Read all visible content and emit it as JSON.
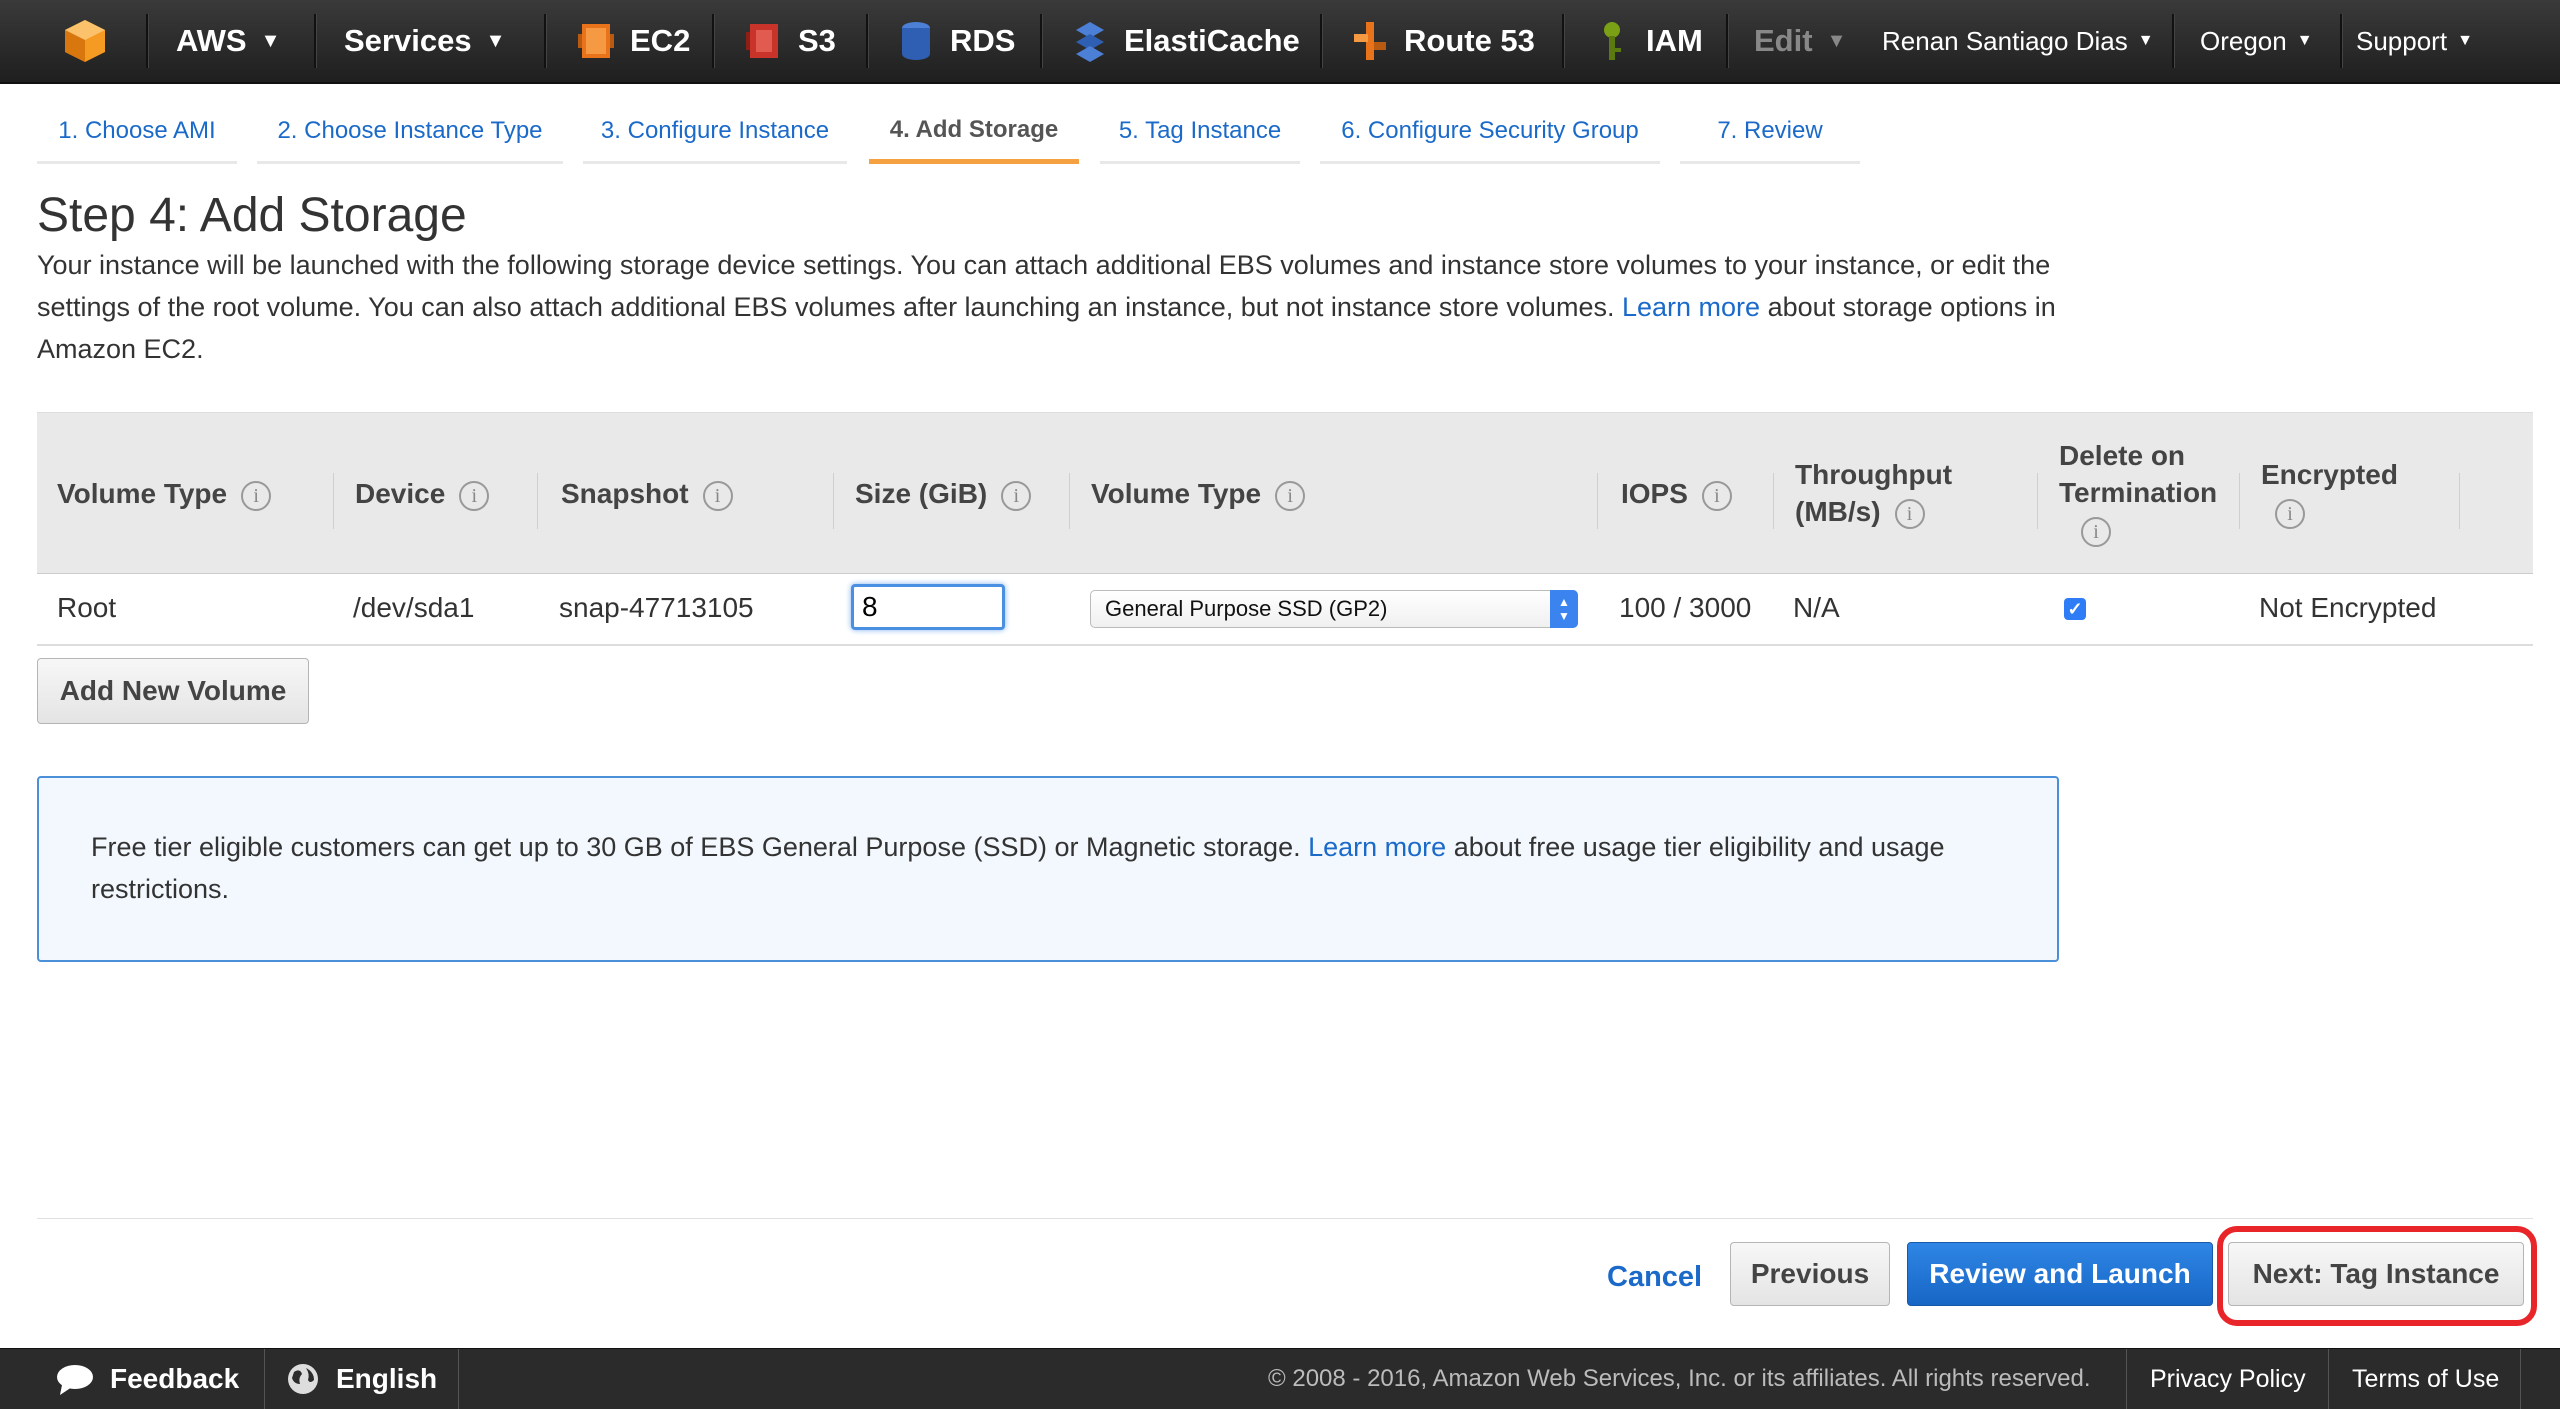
{
  "nav": {
    "aws": "AWS",
    "services": "Services",
    "ec2": "EC2",
    "s3": "S3",
    "rds": "RDS",
    "elasticache": "ElastiCache",
    "route53": "Route 53",
    "iam": "IAM",
    "edit": "Edit",
    "user": "Renan Santiago Dias",
    "region": "Oregon",
    "support": "Support"
  },
  "tabs": [
    {
      "label": "1. Choose AMI"
    },
    {
      "label": "2. Choose Instance Type"
    },
    {
      "label": "3. Configure Instance"
    },
    {
      "label": "4. Add Storage"
    },
    {
      "label": "5. Tag Instance"
    },
    {
      "label": "6. Configure Security Group"
    },
    {
      "label": "7. Review"
    }
  ],
  "page": {
    "title": "Step 4: Add Storage",
    "desc_1": "Your instance will be launched with the following storage device settings. You can attach additional EBS volumes and instance store volumes to your instance, or edit the settings of the root volume. You can also attach additional EBS volumes after launching an instance, but not instance store volumes.",
    "desc_link": "Learn more",
    "desc_2": "about storage options in Amazon EC2."
  },
  "table": {
    "headers": {
      "volume_type": "Volume Type",
      "device": "Device",
      "snapshot": "Snapshot",
      "size": "Size (GiB)",
      "volume_type2": "Volume Type",
      "iops": "IOPS",
      "throughput_1": "Throughput",
      "throughput_2": "(MB/s)",
      "delete_1": "Delete on",
      "delete_2": "Termination",
      "encrypted": "Encrypted"
    },
    "row": {
      "volume_type": "Root",
      "device": "/dev/sda1",
      "snapshot": "snap-47713105",
      "size": "8",
      "ebs_type": "General Purpose SSD (GP2)",
      "iops": "100 / 3000",
      "throughput": "N/A",
      "delete_on_termination": true,
      "encrypted": "Not Encrypted"
    }
  },
  "add_volume_label": "Add New Volume",
  "notice": {
    "text_1": "Free tier eligible customers can get up to 30 GB of EBS General Purpose (SSD) or Magnetic storage.",
    "link": "Learn more",
    "text_2": "about free usage tier eligibility and usage restrictions."
  },
  "actions": {
    "cancel": "Cancel",
    "previous": "Previous",
    "review_launch": "Review and Launch",
    "next": "Next: Tag Instance"
  },
  "footer": {
    "feedback": "Feedback",
    "language": "English",
    "copyright": "© 2008 - 2016, Amazon Web Services, Inc. or its affiliates. All rights reserved.",
    "privacy": "Privacy Policy",
    "terms": "Terms of Use"
  },
  "colors": {
    "accent_tab": "#f5a142",
    "link": "#1b6ac9",
    "primary_button": "#1766c6",
    "highlight": "#e8262a"
  }
}
